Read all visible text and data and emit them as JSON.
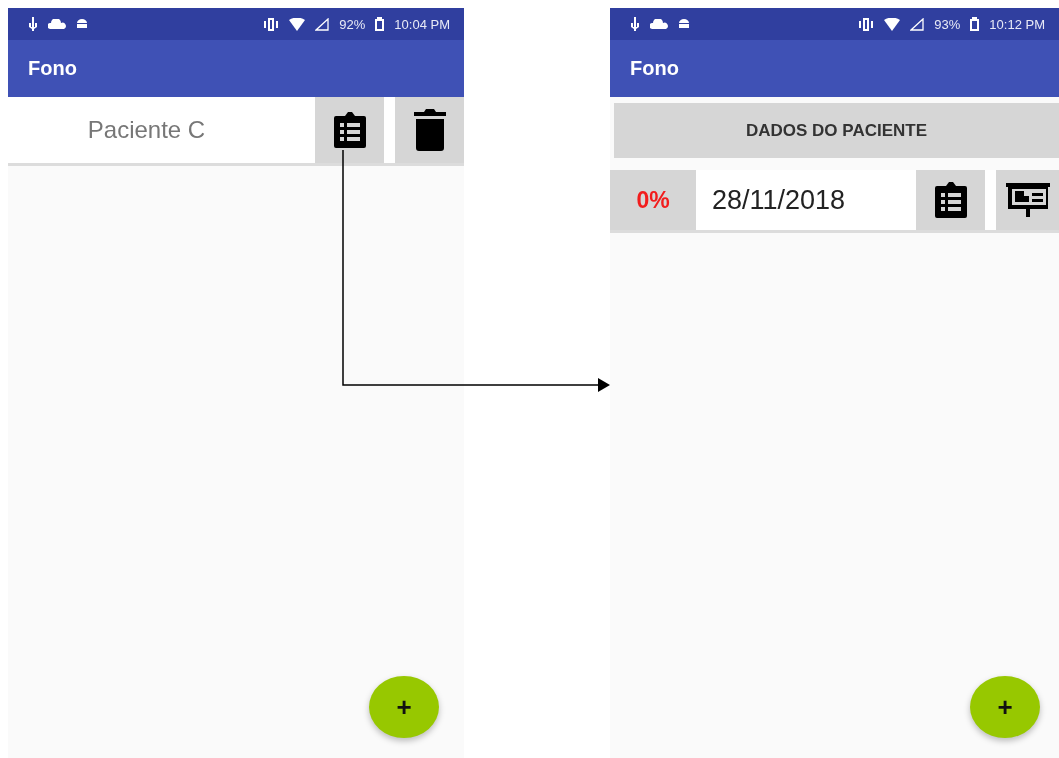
{
  "screens": [
    {
      "status_bar": {
        "battery": "92%",
        "time": "10:04 PM"
      },
      "app_bar": {
        "title": "Fono"
      },
      "kind": "patient_list",
      "rows": [
        {
          "name": "Paciente C"
        }
      ],
      "fab": "+"
    },
    {
      "status_bar": {
        "battery": "93%",
        "time": "10:12 PM"
      },
      "app_bar": {
        "title": "Fono"
      },
      "kind": "sessions",
      "header_button": "DADOS DO PACIENTE",
      "rows": [
        {
          "score": "0%",
          "date": "28/11/2018"
        }
      ],
      "fab": "+"
    }
  ]
}
